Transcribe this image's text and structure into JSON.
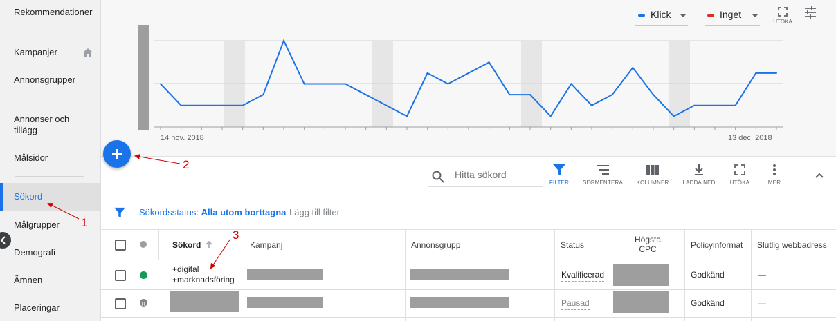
{
  "sidebar": {
    "items": [
      {
        "label": "Rekommendationer"
      },
      {
        "label": "Kampanjer"
      },
      {
        "label": "Annonsgrupper"
      },
      {
        "label": "Annonser och\ntillägg"
      },
      {
        "label": "Målsidor"
      },
      {
        "label": "Sökord"
      },
      {
        "label": "Målgrupper"
      },
      {
        "label": "Demografi"
      },
      {
        "label": "Ämnen"
      },
      {
        "label": "Placeringar"
      }
    ],
    "active_item": "Sökord"
  },
  "chart": {
    "legend": [
      {
        "label": "Klick",
        "color": "#1a73e8"
      },
      {
        "label": "Inget",
        "color": "#d93025"
      }
    ],
    "expand_label": "UTÖKA",
    "start_date": "14 nov. 2018",
    "end_date": "13 dec. 2018"
  },
  "chart_data": {
    "type": "line",
    "x_start": "14 nov. 2018",
    "x_end": "13 dec. 2018",
    "series": [
      {
        "name": "Klick",
        "color": "#1a73e8",
        "values": [
          2,
          1,
          1,
          1,
          1,
          1.5,
          4,
          2,
          2,
          2,
          1.5,
          1,
          0.5,
          2.5,
          2,
          2.5,
          3,
          1.5,
          1.5,
          0.5,
          2,
          1,
          1.5,
          2.75,
          1.5,
          0.5,
          1,
          1,
          1,
          2.5,
          2.5
        ]
      }
    ],
    "grid": true
  },
  "toolbar": {
    "search_placeholder": "Hitta sökord",
    "buttons": [
      {
        "label": "FILTER"
      },
      {
        "label": "SEGMENTERA"
      },
      {
        "label": "KOLUMNER"
      },
      {
        "label": "LADDA NED"
      },
      {
        "label": "UTÖKA"
      },
      {
        "label": "MER"
      }
    ]
  },
  "filter": {
    "prefix": "Sökordsstatus:",
    "value": "Alla utom borttagna",
    "add_filter": "Lägg till filter"
  },
  "table": {
    "columns": [
      "Sökord",
      "Kampanj",
      "Annonsgrupp",
      "Status",
      "Högsta\nCPC",
      "Policyinformat",
      "Slutlig webbadress"
    ],
    "rows": [
      {
        "keyword": "+digital\n+marknadsföring",
        "status": "Kvalificerad",
        "policy": "Godkänd",
        "url": "—"
      },
      {
        "keyword": "",
        "status": "Pausad",
        "policy": "Godkänd",
        "url": "—"
      }
    ]
  },
  "annotations": [
    "1",
    "2",
    "3"
  ]
}
